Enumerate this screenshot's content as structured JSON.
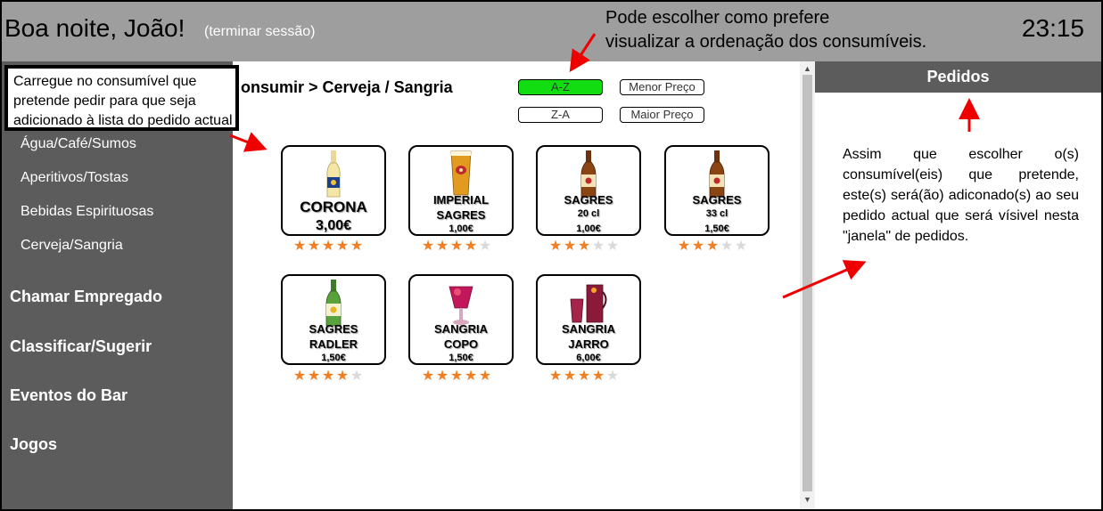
{
  "header": {
    "greeting": "Boa noite, João!",
    "logout": "(terminar sessão)",
    "clock": "23:15"
  },
  "annotations": {
    "top": [
      "Pode escolher como prefere",
      "visualizar a ordenação dos consumíveis."
    ],
    "left": [
      "Carregue no consumível que",
      "pretende pedir para que seja",
      "adicionado à lista do pedido actual"
    ],
    "orders": "Assim que escolher o(s) consumível(eis) que pretende, este(s) será(ão) adiconado(s) ao seu pedido actual que será vísivel nesta \"janela\" de pedidos."
  },
  "sidebar": {
    "sub_items": [
      "Água/Café/Sumos",
      "Aperitivos/Tostas",
      "Bebidas Espirituosas",
      "Cerveja/Sangria"
    ],
    "main_items": [
      "Chamar Empregado",
      "Classificar/Sugerir",
      "Eventos do Bar",
      "Jogos"
    ]
  },
  "content": {
    "breadcrumb": "onsumir > Cerveja / Sangria",
    "sort": {
      "az": "A-Z",
      "za": "Z-A",
      "cheapest": "Menor Preço",
      "expensive": "Maior Preço",
      "active": "A-Z"
    }
  },
  "products": [
    {
      "lines": [
        "CORONA",
        "3,00€"
      ],
      "rating": 5
    },
    {
      "lines": [
        "IMPERIAL",
        "SAGRES",
        "1,00€"
      ],
      "rating": 4
    },
    {
      "lines": [
        "SAGRES",
        "20 cl",
        "1,00€"
      ],
      "rating": 3
    },
    {
      "lines": [
        "SAGRES",
        "33 cl",
        "1,50€"
      ],
      "rating": 3
    },
    {
      "lines": [
        "SAGRES",
        "RADLER",
        "1,50€"
      ],
      "rating": 4
    },
    {
      "lines": [
        "SANGRIA",
        "COPO",
        "1,50€"
      ],
      "rating": 5
    },
    {
      "lines": [
        "SANGRIA",
        "JARRO",
        "6,00€"
      ],
      "rating": 4
    }
  ],
  "orders": {
    "title": "Pedidos"
  },
  "colors": {
    "header_bg": "#9e9e9e",
    "sidebar_bg": "#5c5c5c",
    "active_sort": "#11dd11",
    "star": "#f07e23",
    "arrow": "#ee0000"
  }
}
